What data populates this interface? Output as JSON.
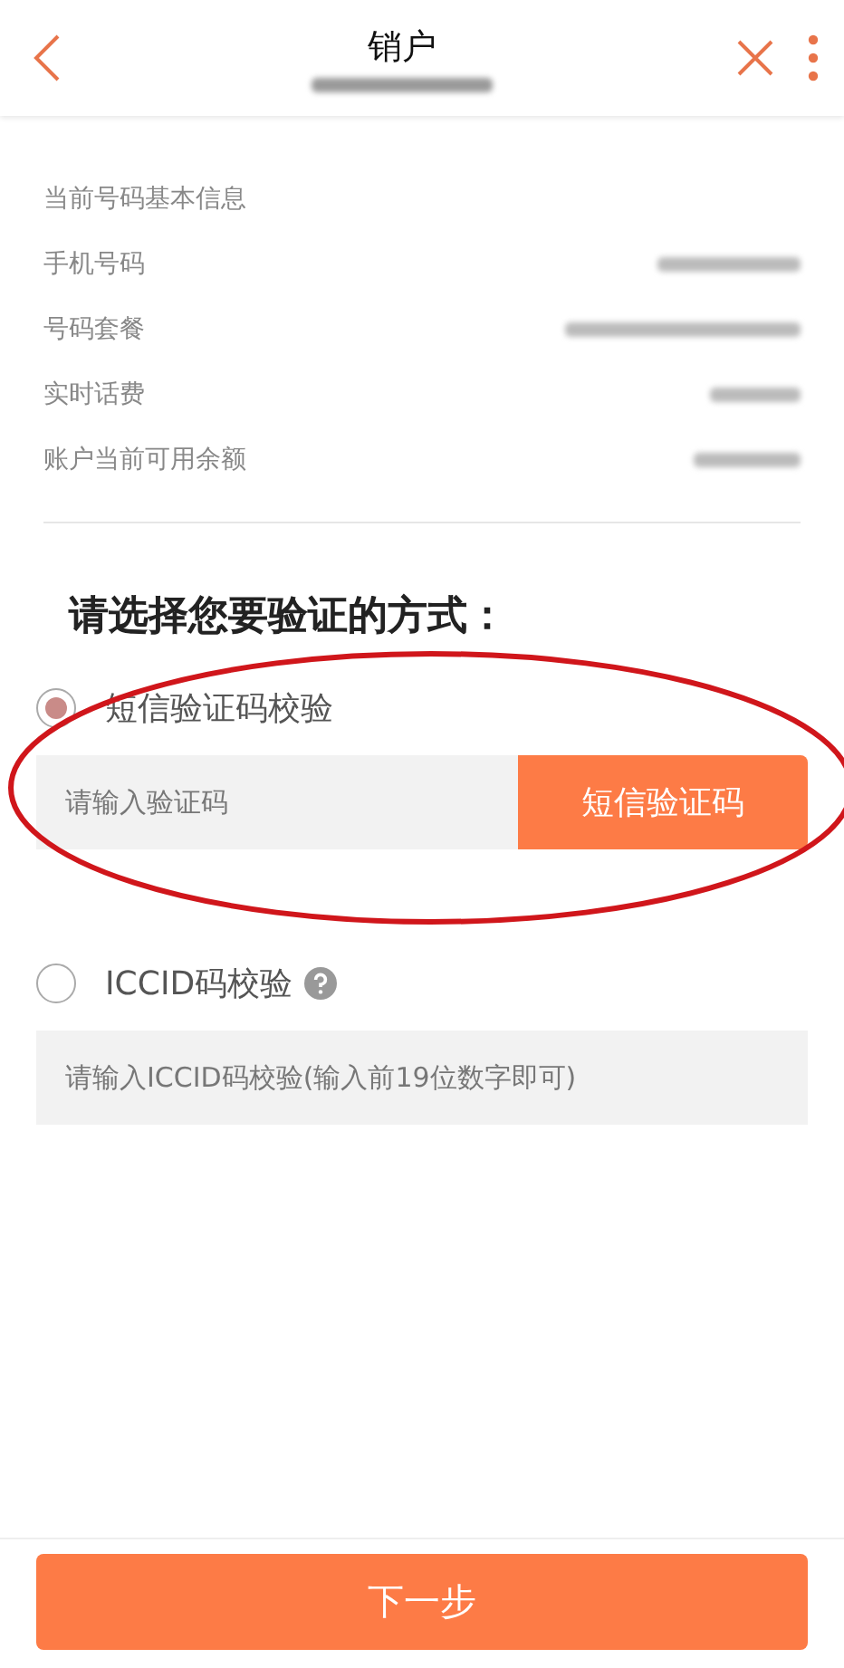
{
  "header": {
    "title": "销户"
  },
  "info": {
    "title": "当前号码基本信息",
    "rows": [
      {
        "label": "手机号码"
      },
      {
        "label": "号码套餐"
      },
      {
        "label": "实时话费"
      },
      {
        "label": "账户当前可用余额"
      }
    ]
  },
  "prompt": "请选择您要验证的方式：",
  "options": [
    {
      "label": "短信验证码校验",
      "selected": true,
      "help": false,
      "placeholder": "请输入验证码",
      "button": "短信验证码"
    },
    {
      "label": "ICCID码校验",
      "selected": false,
      "help": true,
      "placeholder": "请输入ICCID码校验(输入前19位数字即可)"
    }
  ],
  "next_button": "下一步"
}
